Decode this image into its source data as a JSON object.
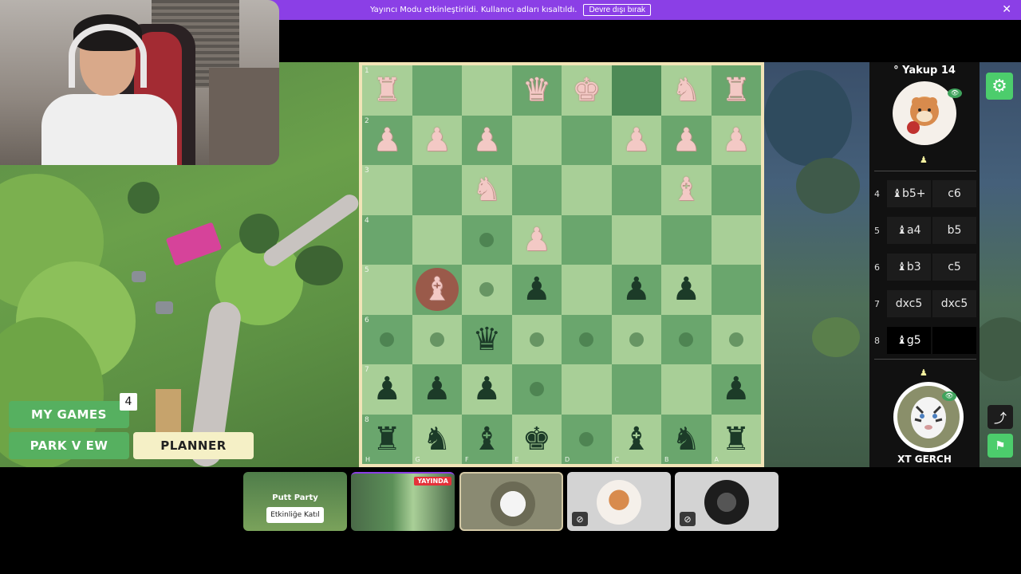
{
  "notice": {
    "message": "Yayıncı Modu etkinleştirildi. Kullanıcı adları kısaltıldı.",
    "disable_label": "Devre dışı bırak",
    "close_icon": "close-icon"
  },
  "colors": {
    "notice_bar": "#8b3fe6",
    "board_light": "#a8cf97",
    "board_dark": "#6aa66d",
    "accent_green": "#4ccd6c",
    "live_red": "#e5313a"
  },
  "board": {
    "rank_labels": [
      "1",
      "2",
      "3",
      "4",
      "5",
      "6",
      "7",
      "8"
    ],
    "file_labels": [
      "H",
      "G",
      "F",
      "E",
      "D",
      "C",
      "B",
      "A"
    ],
    "squares": [
      [
        "wR",
        "",
        "",
        "wQ",
        "wK",
        "hl",
        "wN",
        "wR"
      ],
      [
        "wP",
        "wP",
        "wP",
        "",
        "",
        "wP",
        "wP",
        "wP"
      ],
      [
        "",
        "",
        "wN",
        "",
        "",
        "",
        "wB",
        ""
      ],
      [
        "",
        "",
        "dot",
        "wP",
        "",
        "",
        "",
        ""
      ],
      [
        "",
        "wBc",
        "dot",
        "bP",
        "",
        "bP",
        "bP",
        ""
      ],
      [
        "dot",
        "dot",
        "bQ",
        "dot",
        "dot",
        "dot",
        "dot",
        "dot"
      ],
      [
        "bP",
        "bP",
        "bP",
        "dot",
        "",
        "",
        "",
        "bP"
      ],
      [
        "bR",
        "bN",
        "bB",
        "bK",
        "dot",
        "bB",
        "bN",
        "bR"
      ]
    ]
  },
  "panel": {
    "opponent_name": "° Yakup 14",
    "player_name": "XT GERCH",
    "moves": [
      {
        "num": "4",
        "white": "♝b5+",
        "black": "c6"
      },
      {
        "num": "5",
        "white": "♝a4",
        "black": "b5"
      },
      {
        "num": "6",
        "white": "♝b3",
        "black": "c5"
      },
      {
        "num": "7",
        "white": "dxc5",
        "black": "dxc5"
      },
      {
        "num": "8",
        "white": "♝g5",
        "black": ""
      }
    ]
  },
  "menu": {
    "my_games": "MY GAMES",
    "my_games_count": "4",
    "park_view": "PARK V EW",
    "planner": "PLANNER"
  },
  "tiles": {
    "putt_title": "Putt Party",
    "putt_join": "Etkinliğe Katıl",
    "live_label": "YAYINDA"
  }
}
